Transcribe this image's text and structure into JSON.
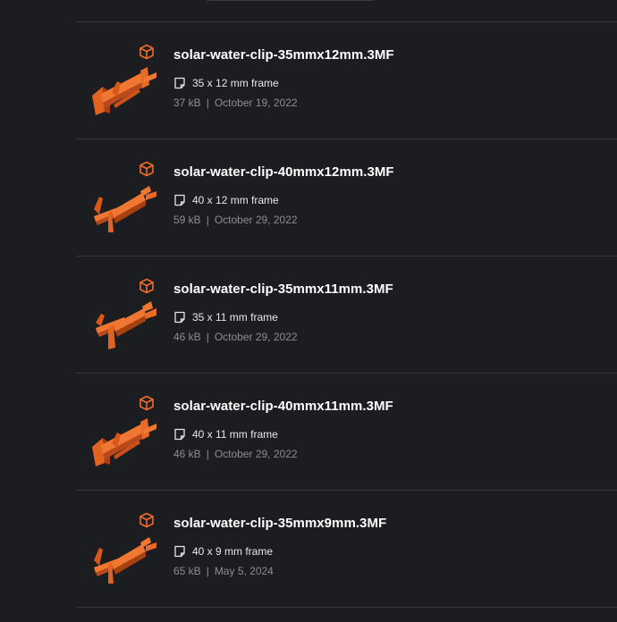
{
  "files": [
    {
      "name": "solar-water-clip-35mmx12mm.3MF",
      "description": "35 x 12 mm frame",
      "size": "37 kB",
      "date": "October 19, 2022"
    },
    {
      "name": "solar-water-clip-40mmx12mm.3MF",
      "description": "40 x 12 mm frame",
      "size": "59 kB",
      "date": "October 29, 2022"
    },
    {
      "name": "solar-water-clip-35mmx11mm.3MF",
      "description": "35 x 11 mm frame",
      "size": "46 kB",
      "date": "October 29, 2022"
    },
    {
      "name": "solar-water-clip-40mmx11mm.3MF",
      "description": "40 x 11 mm frame",
      "size": "46 kB",
      "date": "October 29, 2022"
    },
    {
      "name": "solar-water-clip-35mmx9mm.3MF",
      "description": "40 x 9 mm frame",
      "size": "65 kB",
      "date": "May 5, 2024"
    }
  ],
  "meta_separator": "|",
  "colors": {
    "background": "#1c1d20",
    "divider": "#36373b",
    "accent": "#f26b2a",
    "title": "#ffffff",
    "meta": "#8c8d91"
  },
  "icons": {
    "model": "cube-icon",
    "note": "note-icon",
    "thumbnail": "clip-thumbnail"
  }
}
